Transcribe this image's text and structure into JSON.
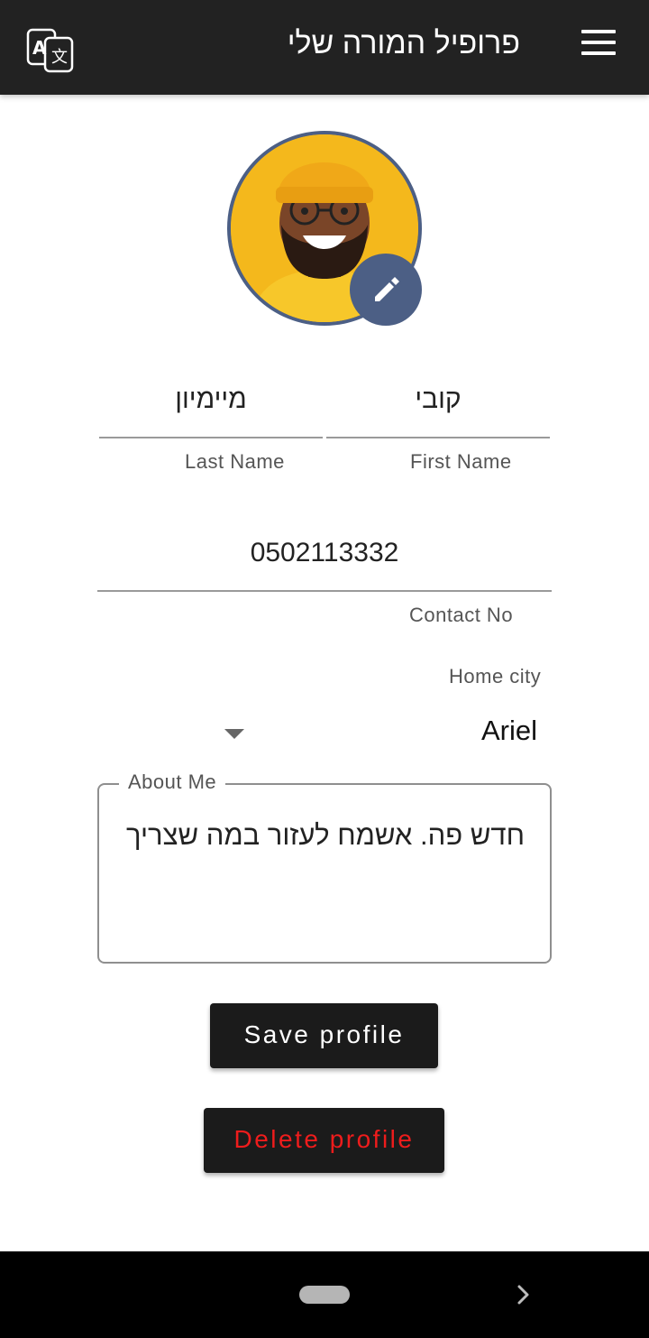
{
  "header": {
    "title": "פרופיל המורה שלי",
    "translate_icon": "translate-icon",
    "menu_icon": "hamburger-menu-icon"
  },
  "profile": {
    "avatar": "profile-photo",
    "edit_icon": "pencil-icon"
  },
  "form": {
    "first_name": {
      "value": "קובי",
      "label": "First Name"
    },
    "last_name": {
      "value": "מיימיון",
      "label": "Last Name"
    },
    "contact": {
      "value": "0502113332",
      "label": "Contact No"
    },
    "home_city": {
      "label": "Home city",
      "value": "Ariel",
      "caret_icon": "dropdown-arrow-icon"
    },
    "about": {
      "label": "About Me",
      "value": "חדש פה. אשמח לעזור במה שצריך"
    }
  },
  "buttons": {
    "save": "Save profile",
    "delete": "Delete profile"
  },
  "system_nav": {
    "home_icon": "home-pill-icon",
    "next_icon": "chevron-right-icon"
  },
  "colors": {
    "header_bg": "#222222",
    "accent": "#4c5f85",
    "button_bg": "#1b1b1b",
    "delete_text": "#ee1c1c"
  }
}
